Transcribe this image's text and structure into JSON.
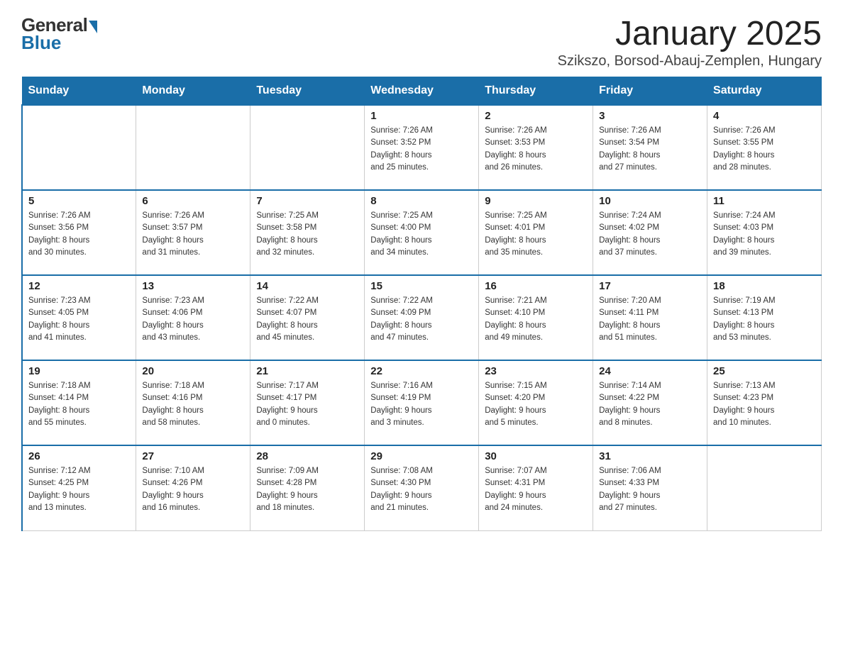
{
  "logo": {
    "general": "General",
    "blue": "Blue"
  },
  "title": "January 2025",
  "subtitle": "Szikszo, Borsod-Abauj-Zemplen, Hungary",
  "days_of_week": [
    "Sunday",
    "Monday",
    "Tuesday",
    "Wednesday",
    "Thursday",
    "Friday",
    "Saturday"
  ],
  "weeks": [
    [
      {
        "day": "",
        "info": ""
      },
      {
        "day": "",
        "info": ""
      },
      {
        "day": "",
        "info": ""
      },
      {
        "day": "1",
        "info": "Sunrise: 7:26 AM\nSunset: 3:52 PM\nDaylight: 8 hours\nand 25 minutes."
      },
      {
        "day": "2",
        "info": "Sunrise: 7:26 AM\nSunset: 3:53 PM\nDaylight: 8 hours\nand 26 minutes."
      },
      {
        "day": "3",
        "info": "Sunrise: 7:26 AM\nSunset: 3:54 PM\nDaylight: 8 hours\nand 27 minutes."
      },
      {
        "day": "4",
        "info": "Sunrise: 7:26 AM\nSunset: 3:55 PM\nDaylight: 8 hours\nand 28 minutes."
      }
    ],
    [
      {
        "day": "5",
        "info": "Sunrise: 7:26 AM\nSunset: 3:56 PM\nDaylight: 8 hours\nand 30 minutes."
      },
      {
        "day": "6",
        "info": "Sunrise: 7:26 AM\nSunset: 3:57 PM\nDaylight: 8 hours\nand 31 minutes."
      },
      {
        "day": "7",
        "info": "Sunrise: 7:25 AM\nSunset: 3:58 PM\nDaylight: 8 hours\nand 32 minutes."
      },
      {
        "day": "8",
        "info": "Sunrise: 7:25 AM\nSunset: 4:00 PM\nDaylight: 8 hours\nand 34 minutes."
      },
      {
        "day": "9",
        "info": "Sunrise: 7:25 AM\nSunset: 4:01 PM\nDaylight: 8 hours\nand 35 minutes."
      },
      {
        "day": "10",
        "info": "Sunrise: 7:24 AM\nSunset: 4:02 PM\nDaylight: 8 hours\nand 37 minutes."
      },
      {
        "day": "11",
        "info": "Sunrise: 7:24 AM\nSunset: 4:03 PM\nDaylight: 8 hours\nand 39 minutes."
      }
    ],
    [
      {
        "day": "12",
        "info": "Sunrise: 7:23 AM\nSunset: 4:05 PM\nDaylight: 8 hours\nand 41 minutes."
      },
      {
        "day": "13",
        "info": "Sunrise: 7:23 AM\nSunset: 4:06 PM\nDaylight: 8 hours\nand 43 minutes."
      },
      {
        "day": "14",
        "info": "Sunrise: 7:22 AM\nSunset: 4:07 PM\nDaylight: 8 hours\nand 45 minutes."
      },
      {
        "day": "15",
        "info": "Sunrise: 7:22 AM\nSunset: 4:09 PM\nDaylight: 8 hours\nand 47 minutes."
      },
      {
        "day": "16",
        "info": "Sunrise: 7:21 AM\nSunset: 4:10 PM\nDaylight: 8 hours\nand 49 minutes."
      },
      {
        "day": "17",
        "info": "Sunrise: 7:20 AM\nSunset: 4:11 PM\nDaylight: 8 hours\nand 51 minutes."
      },
      {
        "day": "18",
        "info": "Sunrise: 7:19 AM\nSunset: 4:13 PM\nDaylight: 8 hours\nand 53 minutes."
      }
    ],
    [
      {
        "day": "19",
        "info": "Sunrise: 7:18 AM\nSunset: 4:14 PM\nDaylight: 8 hours\nand 55 minutes."
      },
      {
        "day": "20",
        "info": "Sunrise: 7:18 AM\nSunset: 4:16 PM\nDaylight: 8 hours\nand 58 minutes."
      },
      {
        "day": "21",
        "info": "Sunrise: 7:17 AM\nSunset: 4:17 PM\nDaylight: 9 hours\nand 0 minutes."
      },
      {
        "day": "22",
        "info": "Sunrise: 7:16 AM\nSunset: 4:19 PM\nDaylight: 9 hours\nand 3 minutes."
      },
      {
        "day": "23",
        "info": "Sunrise: 7:15 AM\nSunset: 4:20 PM\nDaylight: 9 hours\nand 5 minutes."
      },
      {
        "day": "24",
        "info": "Sunrise: 7:14 AM\nSunset: 4:22 PM\nDaylight: 9 hours\nand 8 minutes."
      },
      {
        "day": "25",
        "info": "Sunrise: 7:13 AM\nSunset: 4:23 PM\nDaylight: 9 hours\nand 10 minutes."
      }
    ],
    [
      {
        "day": "26",
        "info": "Sunrise: 7:12 AM\nSunset: 4:25 PM\nDaylight: 9 hours\nand 13 minutes."
      },
      {
        "day": "27",
        "info": "Sunrise: 7:10 AM\nSunset: 4:26 PM\nDaylight: 9 hours\nand 16 minutes."
      },
      {
        "day": "28",
        "info": "Sunrise: 7:09 AM\nSunset: 4:28 PM\nDaylight: 9 hours\nand 18 minutes."
      },
      {
        "day": "29",
        "info": "Sunrise: 7:08 AM\nSunset: 4:30 PM\nDaylight: 9 hours\nand 21 minutes."
      },
      {
        "day": "30",
        "info": "Sunrise: 7:07 AM\nSunset: 4:31 PM\nDaylight: 9 hours\nand 24 minutes."
      },
      {
        "day": "31",
        "info": "Sunrise: 7:06 AM\nSunset: 4:33 PM\nDaylight: 9 hours\nand 27 minutes."
      },
      {
        "day": "",
        "info": ""
      }
    ]
  ]
}
